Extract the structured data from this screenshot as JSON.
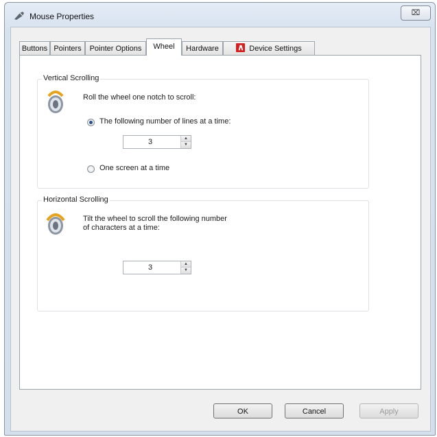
{
  "window": {
    "title": "Mouse Properties",
    "close_label": "⌧"
  },
  "tabs": [
    {
      "label": "Buttons"
    },
    {
      "label": "Pointers"
    },
    {
      "label": "Pointer Options"
    },
    {
      "label": "Wheel",
      "active": true
    },
    {
      "label": "Hardware"
    },
    {
      "label": "Device Settings",
      "icon": "device-settings-icon"
    }
  ],
  "vertical": {
    "group_label": "Vertical Scrolling",
    "instruction": "Roll the wheel one notch to scroll:",
    "option_lines_label": "The following number of lines at a time:",
    "lines_value": "3",
    "option_screen_label": "One screen at a time"
  },
  "horizontal": {
    "group_label": "Horizontal Scrolling",
    "instruction_line1": "Tilt the wheel to scroll the following number",
    "instruction_line2": "of characters at a time:",
    "chars_value": "3"
  },
  "buttons": {
    "ok": "OK",
    "cancel": "Cancel",
    "apply": "Apply"
  },
  "colors": {
    "device_settings_icon": "#d62020",
    "wheel_icon_gold": "#e6a21c"
  }
}
